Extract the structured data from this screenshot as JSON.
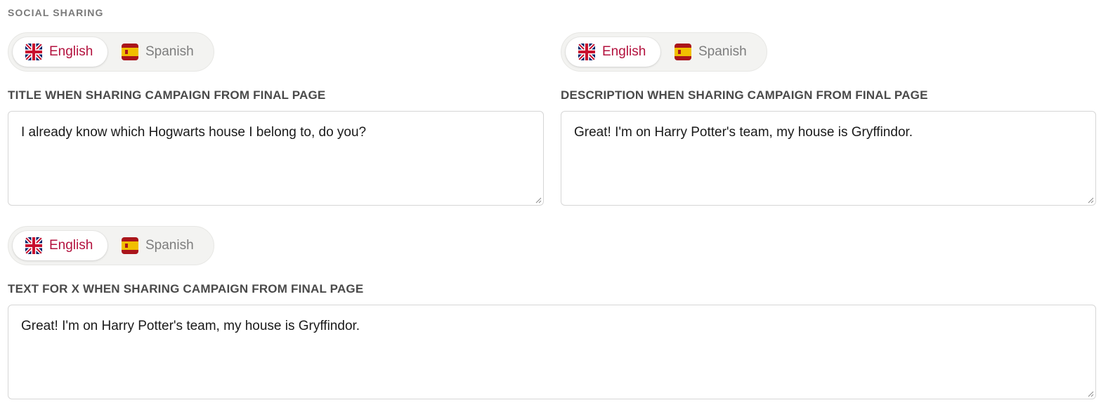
{
  "section": {
    "title": "SOCIAL SHARING"
  },
  "languages": {
    "english": "English",
    "spanish": "Spanish",
    "active": "English"
  },
  "fields": {
    "title": {
      "label": "TITLE WHEN SHARING CAMPAIGN FROM FINAL PAGE",
      "value": "I already know which Hogwarts house I belong to, do you?"
    },
    "description": {
      "label": "DESCRIPTION WHEN SHARING CAMPAIGN FROM FINAL PAGE",
      "value": "Great! I'm on Harry Potter's team, my house is Gryffindor."
    },
    "x_text": {
      "label": "TEXT FOR X WHEN SHARING CAMPAIGN FROM FINAL PAGE",
      "value": "Great! I'm on Harry Potter's team, my house is Gryffindor."
    }
  },
  "colors": {
    "active_language": "#b3123e",
    "inactive_language": "#7d7d7d",
    "toggle_background": "#f3f3f1",
    "label": "#4a4a4a"
  },
  "icons": {
    "english_flag": "uk-flag-icon",
    "spanish_flag": "spain-flag-icon",
    "resize": "resize-handle-icon"
  }
}
